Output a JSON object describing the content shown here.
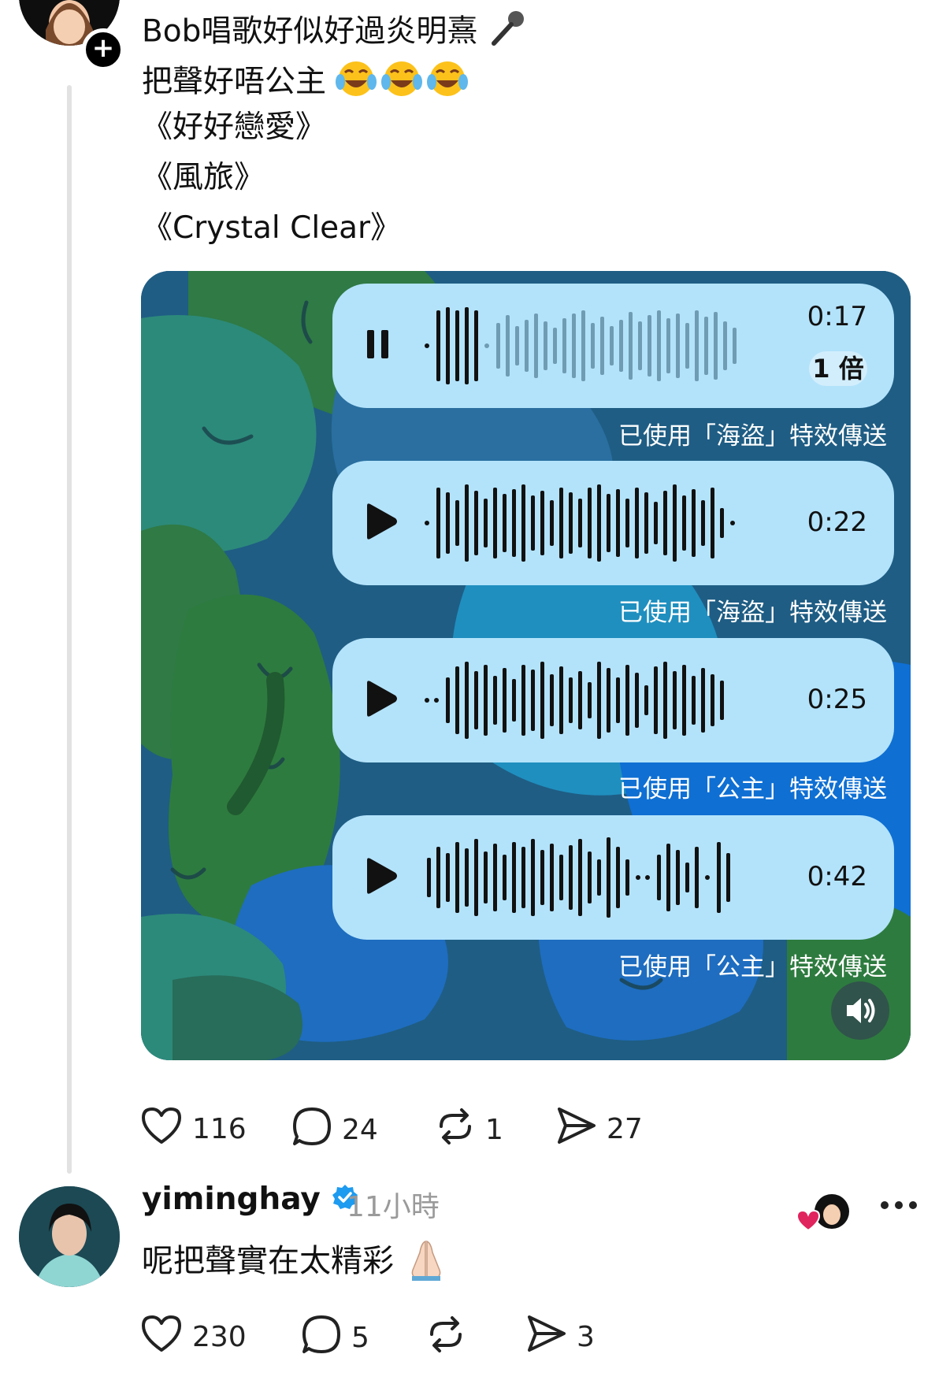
{
  "post": {
    "lines": [
      "Bob唱歌好似好過炎明熹",
      "把聲好唔公主",
      "《好好戀愛》",
      "《風旅》",
      "《Crystal Clear》"
    ],
    "line1_emoji_icon": "microphone-icon",
    "line2_emoji_icon": "tears-of-joy-icon",
    "voice_messages": [
      {
        "state": "pause",
        "duration": "0:17",
        "speed": "1 倍",
        "effect": "已使用「海盜」特效傳送"
      },
      {
        "state": "play",
        "duration": "0:22",
        "effect": "已使用「海盜」特效傳送"
      },
      {
        "state": "play",
        "duration": "0:25",
        "effect": "已使用「公主」特效傳送"
      },
      {
        "state": "play",
        "duration": "0:42",
        "effect": "已使用「公主」特效傳送"
      }
    ],
    "actions": {
      "likes": "116",
      "comments": "24",
      "reposts": "1",
      "shares": "27"
    }
  },
  "reply": {
    "username": "yiminghay",
    "verified": true,
    "time": "11小時",
    "text": "呢把聲實在太精彩",
    "text_emoji_icon": "folded-hands-icon",
    "actions": {
      "likes": "230",
      "comments": "5",
      "reposts": "",
      "shares": "3"
    }
  },
  "colors": {
    "bubble": "#b3e3fb",
    "verified": "#1d9bf0",
    "heart": "#e0245e"
  }
}
